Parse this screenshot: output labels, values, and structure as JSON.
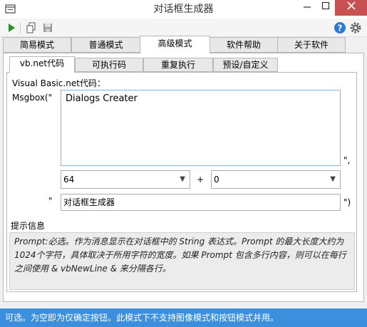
{
  "window": {
    "title": "对话框生成器"
  },
  "toolbar": {
    "run_icon_color": "#2e8b2e",
    "help_icon_color": "#2a7ad5"
  },
  "outer_tabs": [
    "简易模式",
    "普通模式",
    "高级模式",
    "软件帮助",
    "关于软件"
  ],
  "outer_selected": "高级模式",
  "inner_tabs": [
    "vb.net代码",
    "可执行码",
    "重复执行",
    "预设/自定义"
  ],
  "inner_selected": "vb.net代码",
  "code": {
    "heading": "Visual Basic.net代码：",
    "msgbox_prefix": "Msgbox(\"",
    "prompt_text": "Dialogs Creater",
    "after_prompt": "\",",
    "buttons_value": "64",
    "plus": "+",
    "second_value": "0",
    "title_quote": "\"",
    "title_value": "对话框生成器",
    "close_paren": "\")"
  },
  "tip": {
    "heading": "提示信息",
    "text": "Prompt:必选。作为消息显示在对话框中的 String 表达式。Prompt 的最大长度大约为 1024个字符，具体取决于所用字符的宽度。如果 Prompt 包含多行内容，则可以在每行之间使用 & vbNewLine & 来分隔各行。"
  },
  "status": {
    "text": "可选。为空即为仅确定按钮。此模式下不支持图像模式和按钮模式并用。"
  },
  "colors": {
    "status_bar": "#3c8fdc",
    "close_button": "#c75050",
    "focus_border": "#7eb4ea"
  }
}
